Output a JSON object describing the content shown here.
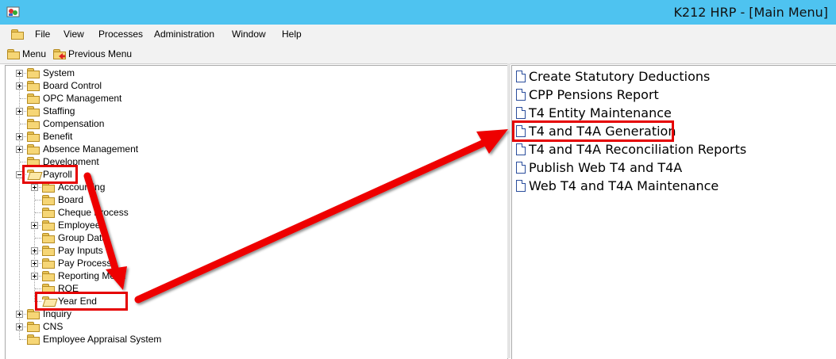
{
  "window": {
    "title": "K212 HRP - [Main Menu]",
    "icon": "app-icon"
  },
  "menu_bar": [
    "File",
    "View",
    "Processes",
    "Administration",
    "Window",
    "Help"
  ],
  "toolbar": {
    "menu_label": "Menu",
    "previous_menu_label": "Previous Menu"
  },
  "tree": [
    {
      "label": "System",
      "expandable": true
    },
    {
      "label": "Board Control",
      "expandable": true
    },
    {
      "label": "OPC Management",
      "expandable": false
    },
    {
      "label": "Staffing",
      "expandable": true
    },
    {
      "label": "Compensation",
      "expandable": false
    },
    {
      "label": "Benefit",
      "expandable": true
    },
    {
      "label": "Absence Management",
      "expandable": true
    },
    {
      "label": "Development",
      "expandable": false
    },
    {
      "label": "Payroll",
      "expanded": true,
      "highlighted": true,
      "children": [
        {
          "label": "Accounting",
          "expandable": true
        },
        {
          "label": "Board",
          "expandable": false
        },
        {
          "label": "Cheque Process",
          "expandable": false
        },
        {
          "label": "Employee",
          "expandable": true
        },
        {
          "label": "Group Data",
          "expandable": false
        },
        {
          "label": "Pay Inputs",
          "expandable": true
        },
        {
          "label": "Pay Process",
          "expandable": true
        },
        {
          "label": "Reporting Menu",
          "expandable": true
        },
        {
          "label": "ROE",
          "expandable": false
        },
        {
          "label": "Year End",
          "expandable": false,
          "selected": true,
          "highlighted": true
        }
      ]
    },
    {
      "label": "Inquiry",
      "expandable": true
    },
    {
      "label": "CNS",
      "expandable": true
    },
    {
      "label": "Employee Appraisal System",
      "expandable": false
    }
  ],
  "right_list": [
    {
      "label": "Create Statutory Deductions"
    },
    {
      "label": "CPP Pensions Report"
    },
    {
      "label": "T4 Entity Maintenance"
    },
    {
      "label": "T4 and T4A Generation",
      "highlighted": true
    },
    {
      "label": "T4 and T4A Reconciliation Reports"
    },
    {
      "label": "Publish Web T4 and T4A"
    },
    {
      "label": "Web T4 and T4A Maintenance"
    }
  ],
  "colors": {
    "title_bar": "#4ec3f0",
    "highlight": "#e50000",
    "folder": "#f6d676",
    "doc_border": "#2a4d9c"
  }
}
